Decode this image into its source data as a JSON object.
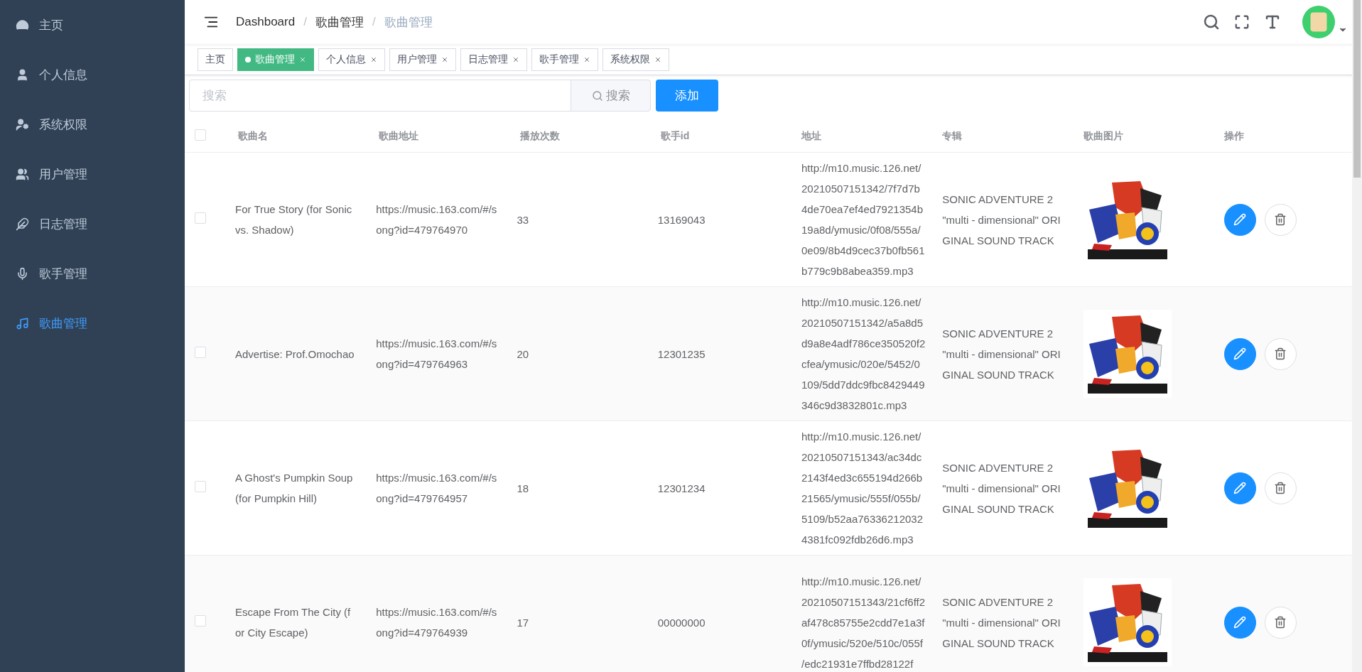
{
  "sidebar": {
    "items": [
      {
        "label": "主页",
        "selected": false
      },
      {
        "label": "个人信息",
        "selected": false
      },
      {
        "label": "系统权限",
        "selected": false
      },
      {
        "label": "用户管理",
        "selected": false
      },
      {
        "label": "日志管理",
        "selected": false
      },
      {
        "label": "歌手管理",
        "selected": false
      },
      {
        "label": "歌曲管理",
        "selected": true
      }
    ]
  },
  "header": {
    "breadcrumb": [
      "Dashboard",
      "歌曲管理",
      "歌曲管理"
    ],
    "separator": "/"
  },
  "tags": [
    {
      "label": "主页",
      "selected": false,
      "closable": false
    },
    {
      "label": "歌曲管理",
      "selected": true,
      "closable": true
    },
    {
      "label": "个人信息",
      "selected": false,
      "closable": true
    },
    {
      "label": "用户管理",
      "selected": false,
      "closable": true
    },
    {
      "label": "日志管理",
      "selected": false,
      "closable": true
    },
    {
      "label": "歌手管理",
      "selected": false,
      "closable": true
    },
    {
      "label": "系统权限",
      "selected": false,
      "closable": true
    }
  ],
  "toolbar": {
    "search": {
      "placeholder": "搜索"
    },
    "search_button": "搜索",
    "add_button": "添加"
  },
  "table": {
    "select_all": {
      "checked": false
    },
    "columns": [
      "歌曲名",
      "歌曲地址",
      "播放次数",
      "歌手id",
      "地址",
      "专辑",
      "歌曲图片",
      "操作"
    ],
    "rows": [
      {
        "checked": false,
        "name": "For True Story (for Sonic vs. Shadow)",
        "url": "https://music.163.com/#/song?id=479764970",
        "plays": "33",
        "singer_id": "13169043",
        "address": "http://m10.music.126.net/20210507151342/7f7d7b4de70ea7ef4ed7921354b19a8d/ymusic/0f08/555a/0e09/8b4d9cec37b0fb561b779c9b8abea359.mp3",
        "album": "SONIC ADVENTURE 2 \"multi - dimensional\" ORIGINAL SOUND TRACK"
      },
      {
        "checked": false,
        "name": "Advertise: Prof.Omochao",
        "url": "https://music.163.com/#/song?id=479764963",
        "plays": "20",
        "singer_id": "12301235",
        "address": "http://m10.music.126.net/20210507151342/a5a8d5d9a8e4adf786ce350520f2cfea/ymusic/020e/5452/0109/5dd7ddc9fbc8429449346c9d3832801c.mp3",
        "album": "SONIC ADVENTURE 2 \"multi - dimensional\" ORIGINAL SOUND TRACK"
      },
      {
        "checked": false,
        "name": "A Ghost's Pumpkin Soup (for Pumpkin Hill)",
        "url": "https://music.163.com/#/song?id=479764957",
        "plays": "18",
        "singer_id": "12301234",
        "address": "http://m10.music.126.net/20210507151343/ac34dc2143f4ed3c655194d266b21565/ymusic/555f/055b/5109/b52aa763362120324381fc092fdb26d6.mp3",
        "album": "SONIC ADVENTURE 2 \"multi - dimensional\" ORIGINAL SOUND TRACK"
      },
      {
        "checked": false,
        "name": "Escape From The City (for City Escape)",
        "url": "https://music.163.com/#/song?id=479764939",
        "plays": "17",
        "singer_id": "00000000",
        "address": "http://m10.music.126.net/20210507151343/21cf6ff2af478c85755e2cdd7e1a3f0f/ymusic/520e/510c/055f/edc21931e7ffbd28122f",
        "album": "SONIC ADVENTURE 2 \"multi - dimensional\" ORIGINAL SOUND TRACK"
      }
    ]
  }
}
